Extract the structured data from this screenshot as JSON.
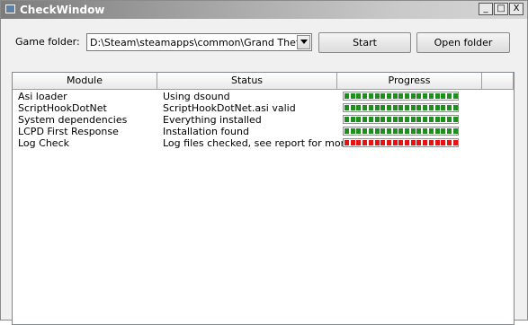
{
  "window": {
    "title": "CheckWindow"
  },
  "caption_buttons": {
    "min": "_",
    "max": "□",
    "close": "X"
  },
  "toolbar": {
    "game_folder_label": "Game folder:",
    "game_folder_value": "D:\\Steam\\steamapps\\common\\Grand Theft Auto IV\\GTAIV",
    "start_label": "Start",
    "open_folder_label": "Open folder"
  },
  "table": {
    "columns": [
      "Module",
      "Status",
      "Progress",
      ""
    ],
    "rows": [
      {
        "module": "Asi loader",
        "status": "Using dsound",
        "progress": 1.0,
        "color": "#1e8f1e"
      },
      {
        "module": "ScriptHookDotNet",
        "status": "ScriptHookDotNet.asi valid",
        "progress": 1.0,
        "color": "#1e8f1e"
      },
      {
        "module": "System dependencies",
        "status": "Everything installed",
        "progress": 1.0,
        "color": "#1e8f1e"
      },
      {
        "module": "LCPD First Response",
        "status": "Installation found",
        "progress": 1.0,
        "color": "#1e8f1e"
      },
      {
        "module": "Log Check",
        "status": "Log files checked, see report for more",
        "progress": 1.0,
        "color": "#e81212"
      }
    ]
  }
}
